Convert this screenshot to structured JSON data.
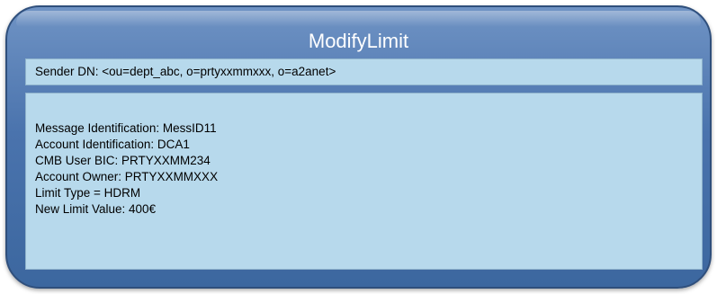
{
  "title": "ModifyLimit",
  "sender_dn": "Sender DN: <ou=dept_abc, o=prtyxxmmxxx, o=a2anet>",
  "details": {
    "lines": [
      "Message Identification: MessID11",
      "Account Identification: DCA1",
      "CMB User BIC: PRTYXXMM234",
      "Account Owner: PRTYXXMMXXX",
      "Limit Type = HDRM",
      "New Limit Value: 400€"
    ]
  },
  "colors": {
    "frame": "#4a73ad",
    "panel": "#b7d9ec",
    "title_text": "#ffffff"
  }
}
